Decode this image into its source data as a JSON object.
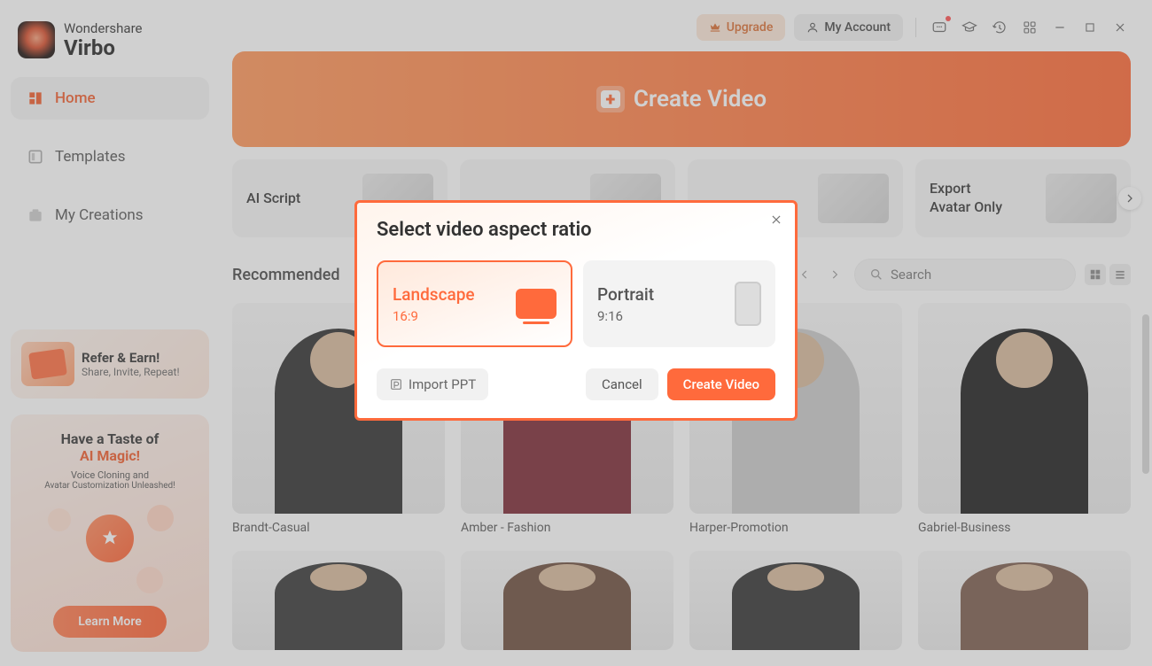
{
  "brand": {
    "company": "Wondershare",
    "product": "Virbo"
  },
  "sidebar": {
    "items": [
      {
        "label": "Home"
      },
      {
        "label": "Templates"
      },
      {
        "label": "My Creations"
      }
    ],
    "refer": {
      "title": "Refer & Earn!",
      "subtitle": "Share, Invite, Repeat!"
    },
    "magic": {
      "line1": "Have a Taste of",
      "line2": "AI Magic!",
      "sub1": "Voice Cloning and",
      "sub2": "Avatar Customization Unleashed!",
      "cta": "Learn More"
    }
  },
  "topbar": {
    "upgrade": "Upgrade",
    "account": "My Account"
  },
  "hero": {
    "label": "Create Video"
  },
  "features": [
    {
      "label": "AI Script"
    },
    {
      "label": ""
    },
    {
      "label": ""
    },
    {
      "label": "Export\nAvatar Only"
    }
  ],
  "recommended": {
    "title": "Recommended",
    "search_placeholder": "Search"
  },
  "avatars_row1": [
    {
      "label": "Brandt-Casual"
    },
    {
      "label": "Amber - Fashion"
    },
    {
      "label": "Harper-Promotion"
    },
    {
      "label": "Gabriel-Business"
    }
  ],
  "modal": {
    "title": "Select video aspect ratio",
    "landscape": {
      "name": "Landscape",
      "ratio": "16:9"
    },
    "portrait": {
      "name": "Portrait",
      "ratio": "9:16"
    },
    "import": "Import PPT",
    "cancel": "Cancel",
    "create": "Create Video"
  }
}
